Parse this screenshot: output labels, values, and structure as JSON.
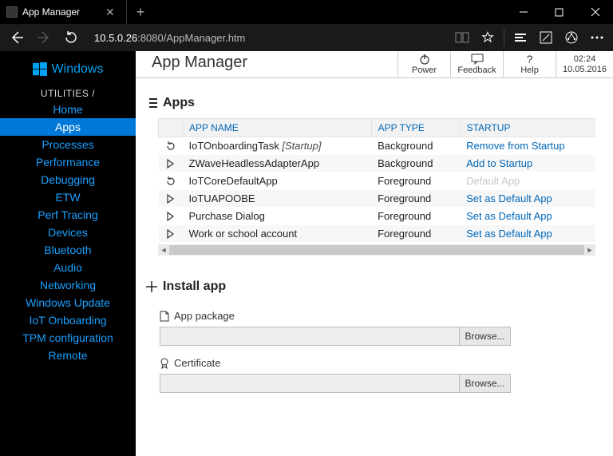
{
  "window": {
    "tab_title": "App Manager"
  },
  "address": {
    "host": "10.5.0.26",
    "rest": ":8080/AppManager.htm"
  },
  "brand": "Windows",
  "side_category": "UTILITIES /",
  "sidebar": [
    {
      "label": "Home"
    },
    {
      "label": "Apps",
      "active": true
    },
    {
      "label": "Processes"
    },
    {
      "label": "Performance"
    },
    {
      "label": "Debugging"
    },
    {
      "label": "ETW"
    },
    {
      "label": "Perf Tracing"
    },
    {
      "label": "Devices"
    },
    {
      "label": "Bluetooth"
    },
    {
      "label": "Audio"
    },
    {
      "label": "Networking"
    },
    {
      "label": "Windows Update"
    },
    {
      "label": "IoT Onboarding"
    },
    {
      "label": "TPM configuration"
    },
    {
      "label": "Remote"
    }
  ],
  "page_title": "App Manager",
  "header_buttons": {
    "power": "Power",
    "feedback": "Feedback",
    "help": "Help"
  },
  "clock": {
    "time": "02:24",
    "date": "10.05.2016"
  },
  "sections": {
    "apps": "Apps",
    "install": "Install app",
    "package": "App package",
    "cert": "Certificate"
  },
  "table": {
    "cols": {
      "name": "APP NAME",
      "type": "APP TYPE",
      "startup": "STARTUP"
    },
    "rows": [
      {
        "icon": "refresh",
        "name": "IoTOnboardingTask",
        "tag": "[Startup]",
        "type": "Background",
        "action": "Remove from Startup",
        "disabled": false
      },
      {
        "icon": "play",
        "name": "ZWaveHeadlessAdapterApp",
        "tag": "",
        "type": "Background",
        "action": "Add to Startup",
        "disabled": false
      },
      {
        "icon": "refresh",
        "name": "IoTCoreDefaultApp",
        "tag": "",
        "type": "Foreground",
        "action": "Default App",
        "disabled": true
      },
      {
        "icon": "play",
        "name": "IoTUAPOOBE",
        "tag": "",
        "type": "Foreground",
        "action": "Set as Default App",
        "disabled": false
      },
      {
        "icon": "play",
        "name": "Purchase Dialog",
        "tag": "",
        "type": "Foreground",
        "action": "Set as Default App",
        "disabled": false
      },
      {
        "icon": "play",
        "name": "Work or school account",
        "tag": "",
        "type": "Foreground",
        "action": "Set as Default App",
        "disabled": false
      }
    ]
  },
  "browse_label": "Browse..."
}
